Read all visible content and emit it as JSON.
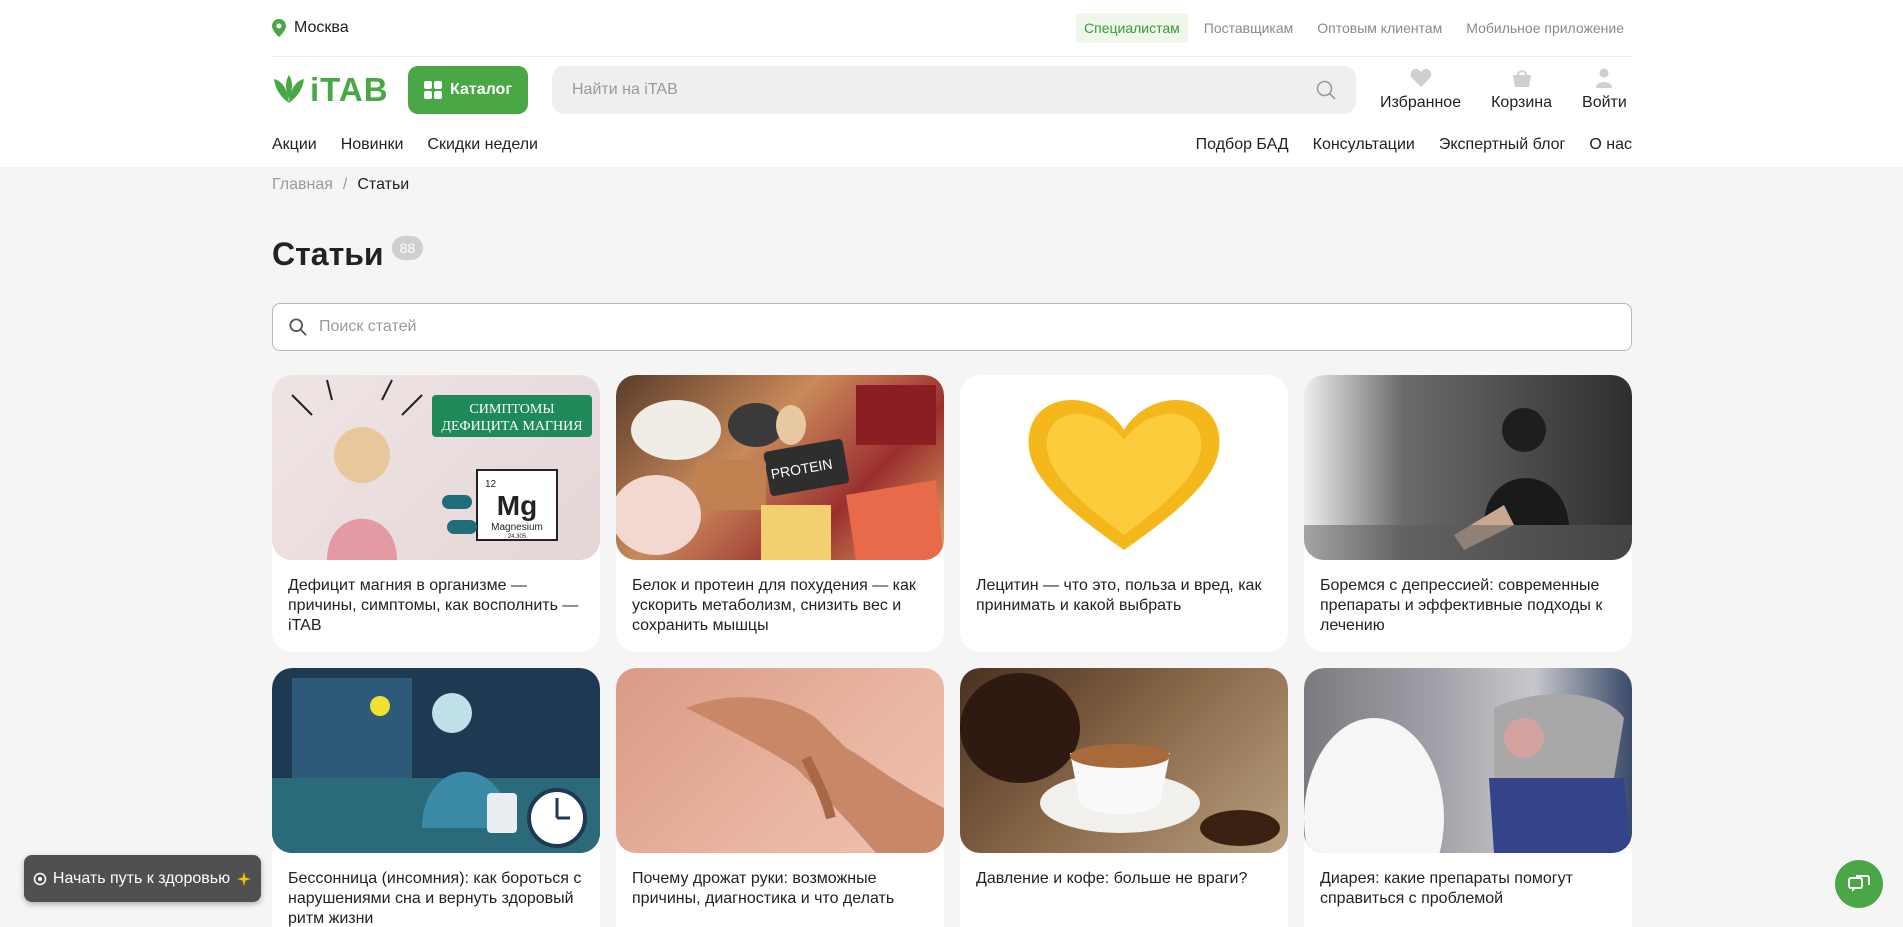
{
  "topbar": {
    "city": "Москва",
    "links": [
      "Специалистам",
      "Поставщикам",
      "Оптовым клиентам",
      "Мобильное приложение"
    ]
  },
  "header": {
    "logo_text": "iTAB",
    "catalog_label": "Каталог",
    "search_placeholder": "Найти на iTAB",
    "favorites_label": "Избранное",
    "cart_label": "Корзина",
    "login_label": "Войти"
  },
  "nav": {
    "left": [
      "Акции",
      "Новинки",
      "Скидки недели"
    ],
    "right": [
      "Подбор БАД",
      "Консультации",
      "Экспертный блог",
      "О нас"
    ]
  },
  "breadcrumb": {
    "home": "Главная",
    "separator": "/",
    "current": "Статьи"
  },
  "page": {
    "title": "Статьи",
    "count": "88",
    "search_placeholder": "Поиск статей"
  },
  "articles": [
    {
      "title": "Дефицит магния в организме — причины, симптомы, как восполнить — iTAB",
      "image_text_1": "СИМПТОМЫ",
      "image_text_2": "ДЕФИЦИТА МАГНИЯ",
      "image_text_3": "Mg",
      "image_text_4": "Magnesium",
      "image_text_5": "12",
      "image_text_6": "24.305"
    },
    {
      "title": "Белок и протеин для похудения — как ускорить метаболизм, снизить вес и сохранить мышцы",
      "image_text_1": "PROTEIN"
    },
    {
      "title": "Лецитин — что это, польза и вред, как принимать и какой выбрать"
    },
    {
      "title": "Боремся с депрессией: современные препараты и эффективные подходы к лечению"
    },
    {
      "title": "Бессонница (инсомния): как бороться с нарушениями сна и вернуть здоровый ритм жизни"
    },
    {
      "title": "Почему дрожат руки: возможные причины, диагностика и что делать"
    },
    {
      "title": "Давление и кофе: больше не враги?"
    },
    {
      "title": "Диарея: какие препараты помогут справиться с проблемой"
    }
  ],
  "promo": {
    "label": "Начать путь к здоровью"
  },
  "colors": {
    "accent": "#49a845",
    "background": "#f5f5f5"
  }
}
